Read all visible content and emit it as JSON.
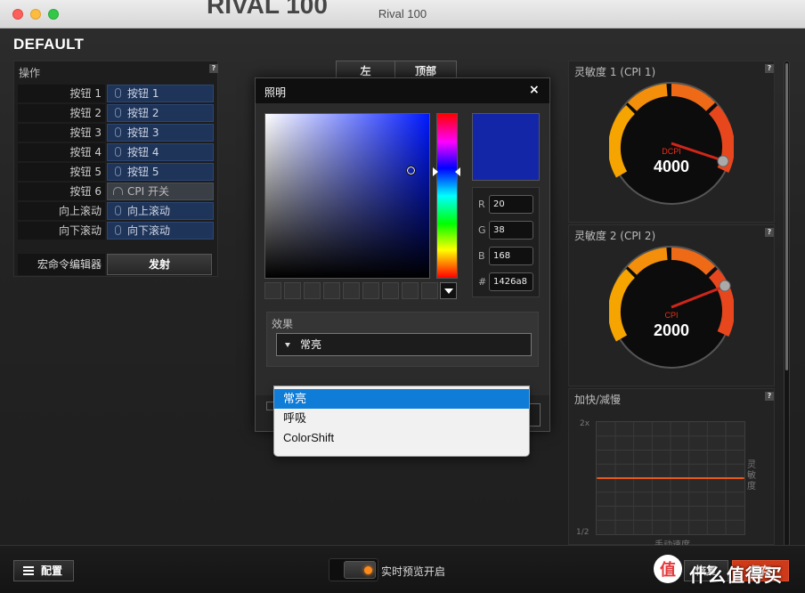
{
  "window": {
    "title": "Rival 100",
    "background_title": "RIVAL 100"
  },
  "profile": {
    "name": "DEFAULT"
  },
  "actions_panel": {
    "header": "操作",
    "help": "?",
    "rows": [
      {
        "button": "按钮 1",
        "value": "按钮 1",
        "icon": "mouse-icon"
      },
      {
        "button": "按钮 2",
        "value": "按钮 2",
        "icon": "mouse-icon"
      },
      {
        "button": "按钮 3",
        "value": "按钮 3",
        "icon": "mouse-icon"
      },
      {
        "button": "按钮 4",
        "value": "按钮 4",
        "icon": "mouse-icon"
      },
      {
        "button": "按钮 5",
        "value": "按钮 5",
        "icon": "mouse-icon"
      },
      {
        "button": "按钮 6",
        "value": "CPI 开关",
        "icon": "gauge-icon"
      },
      {
        "button": "向上滚动",
        "value": "向上滚动",
        "icon": "mouse-icon"
      },
      {
        "button": "向下滚动",
        "value": "向下滚动",
        "icon": "mouse-icon"
      }
    ],
    "macro_label": "宏命令编辑器",
    "macro_button": "发射"
  },
  "mode_tabs": {
    "left": "左",
    "top": "顶部"
  },
  "sensitivity1": {
    "header": "灵敏度 1 (CPI 1)",
    "help": "?",
    "label": "DCPI",
    "value": "4000",
    "level": 0.95
  },
  "sensitivity2": {
    "header": "灵敏度 2 (CPI 2)",
    "help": "?",
    "label": "CPI",
    "value": "2000",
    "level": 0.8
  },
  "accel": {
    "header": "加快/减慢",
    "help": "?",
    "y_top": "2x",
    "y_bottom": "1/2",
    "x_axis": "手动速度",
    "y_axis": "灵敏度"
  },
  "lighting_dialog": {
    "title": "照明",
    "close": "×",
    "color_hex": "#1426a8",
    "r_label": "R",
    "r": "20",
    "g_label": "G",
    "g": "38",
    "b_label": "B",
    "b": "168",
    "hex_label": "#",
    "hex": "1426a8",
    "effect_label": "效果",
    "effect_value": "常亮",
    "effect_options": [
      "常亮",
      "呼吸",
      "ColorShift"
    ]
  },
  "bottom": {
    "config_button": "配置",
    "live_preview": "实时预览开启",
    "live_preview_on": true,
    "reset_button": "恢复",
    "save_button": "保存"
  },
  "watermark": "什么值得买",
  "colors": {
    "accent": "#e05a1a",
    "selection": "#0f7dd8",
    "button_blue": "#1f3459"
  }
}
